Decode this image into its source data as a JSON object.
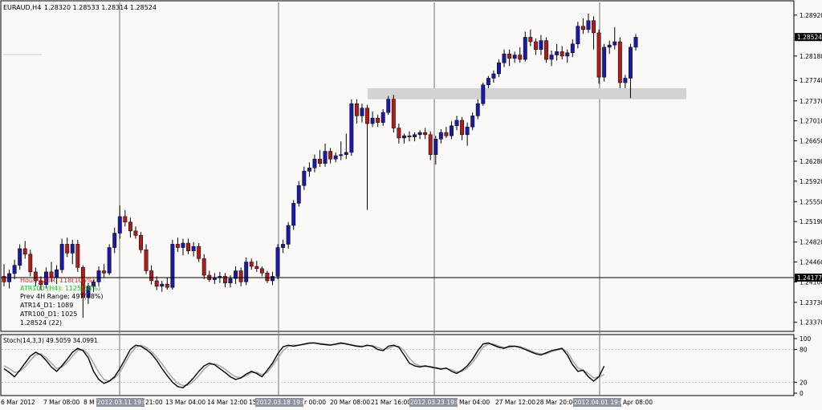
{
  "header": {
    "symbol": "EURAUD,H4",
    "ohlc": "1.28320 1.28533 1.28314 1.28524"
  },
  "indicators": {
    "line1": "Hourly ATR: 118(105%)",
    "line2": "ATR100 (H4): 1125(38%)",
    "line3": "Prev 4H Range: 497(48%)",
    "line4": "ATR14_D1: 1089",
    "line5": "ATR100_D1: 1025",
    "line6": "1.28524 (22)"
  },
  "price_axis": {
    "ticks": [
      "1.28920",
      "1.28180",
      "1.27740",
      "1.27370",
      "1.27010",
      "1.26650",
      "1.26280",
      "1.25920",
      "1.25550",
      "1.25190",
      "1.24820",
      "1.24460",
      "1.24100",
      "1.23730",
      "1.23370"
    ],
    "current_price_label": "1.28524",
    "hline_price_label": "1.24177"
  },
  "stoch_panel": {
    "label": "Stoch(14,3,3) 49.5059 34.0991",
    "levels": [
      "100",
      "80",
      "20",
      "0"
    ]
  },
  "time_axis": {
    "labels": [
      "6 Mar 2012",
      "7 Mar 08:00",
      "8 M",
      "13 Mar 04:00",
      "14 Mar 12:00",
      "15",
      "20 Mar 08:00",
      "21 Mar 16:00",
      "27 Mar 12:00",
      "28 Mar 20:00",
      "Apr 08:00"
    ],
    "highlighted": [
      "2012.03.11 19:00",
      "2012.03.18 19:00",
      "2012.03.23 19:00",
      "2012.04.01 19:00"
    ],
    "partial": [
      "21:00",
      "r 00:00",
      "Mar 04:00"
    ]
  },
  "colors": {
    "bull": "#1a1aa6",
    "bear": "#b01c1c",
    "background": "#fbf8f8",
    "zone": "#d3d3d3"
  },
  "chart_data": {
    "type": "candlestick",
    "ylim": [
      1.2322,
      1.2915
    ],
    "current_price": 1.28524,
    "hline_price": 1.24177,
    "zone": [
      1.274,
      1.276
    ],
    "candles": [
      {
        "o": 1.242,
        "h": 1.2442,
        "l": 1.2402,
        "c": 1.241
      },
      {
        "o": 1.241,
        "h": 1.2432,
        "l": 1.2398,
        "c": 1.2425
      },
      {
        "o": 1.2425,
        "h": 1.245,
        "l": 1.2415,
        "c": 1.244
      },
      {
        "o": 1.244,
        "h": 1.2478,
        "l": 1.2432,
        "c": 1.247
      },
      {
        "o": 1.247,
        "h": 1.2484,
        "l": 1.2452,
        "c": 1.246
      },
      {
        "o": 1.246,
        "h": 1.2468,
        "l": 1.242,
        "c": 1.2428
      },
      {
        "o": 1.2428,
        "h": 1.2436,
        "l": 1.2402,
        "c": 1.2412
      },
      {
        "o": 1.2412,
        "h": 1.242,
        "l": 1.2395,
        "c": 1.2405
      },
      {
        "o": 1.2405,
        "h": 1.2436,
        "l": 1.2398,
        "c": 1.2428
      },
      {
        "o": 1.2428,
        "h": 1.2446,
        "l": 1.241,
        "c": 1.2418
      },
      {
        "o": 1.2418,
        "h": 1.244,
        "l": 1.2406,
        "c": 1.2432
      },
      {
        "o": 1.2432,
        "h": 1.2488,
        "l": 1.2426,
        "c": 1.2478
      },
      {
        "o": 1.2478,
        "h": 1.249,
        "l": 1.2455,
        "c": 1.2462
      },
      {
        "o": 1.2462,
        "h": 1.2486,
        "l": 1.2442,
        "c": 1.2478
      },
      {
        "o": 1.2478,
        "h": 1.2486,
        "l": 1.2428,
        "c": 1.2436
      },
      {
        "o": 1.2436,
        "h": 1.244,
        "l": 1.2345,
        "c": 1.2382
      },
      {
        "o": 1.2382,
        "h": 1.2408,
        "l": 1.237,
        "c": 1.2402
      },
      {
        "o": 1.2402,
        "h": 1.2414,
        "l": 1.2392,
        "c": 1.241
      },
      {
        "o": 1.241,
        "h": 1.2438,
        "l": 1.2402,
        "c": 1.243
      },
      {
        "o": 1.243,
        "h": 1.2442,
        "l": 1.2418,
        "c": 1.2426
      },
      {
        "o": 1.2426,
        "h": 1.2478,
        "l": 1.2422,
        "c": 1.2472
      },
      {
        "o": 1.2472,
        "h": 1.2508,
        "l": 1.2462,
        "c": 1.2498
      },
      {
        "o": 1.2498,
        "h": 1.2548,
        "l": 1.2488,
        "c": 1.2528
      },
      {
        "o": 1.2528,
        "h": 1.254,
        "l": 1.251,
        "c": 1.2518
      },
      {
        "o": 1.2518,
        "h": 1.2526,
        "l": 1.249,
        "c": 1.2502
      },
      {
        "o": 1.2502,
        "h": 1.251,
        "l": 1.2488,
        "c": 1.2494
      },
      {
        "o": 1.2494,
        "h": 1.25,
        "l": 1.2462,
        "c": 1.2468
      },
      {
        "o": 1.2468,
        "h": 1.2478,
        "l": 1.2424,
        "c": 1.243
      },
      {
        "o": 1.243,
        "h": 1.244,
        "l": 1.2405,
        "c": 1.2412
      },
      {
        "o": 1.2412,
        "h": 1.242,
        "l": 1.2395,
        "c": 1.2402
      },
      {
        "o": 1.2402,
        "h": 1.2412,
        "l": 1.2392,
        "c": 1.2406
      },
      {
        "o": 1.2406,
        "h": 1.2418,
        "l": 1.2396,
        "c": 1.24
      },
      {
        "o": 1.24,
        "h": 1.2486,
        "l": 1.2396,
        "c": 1.2478
      },
      {
        "o": 1.2478,
        "h": 1.249,
        "l": 1.2464,
        "c": 1.2472
      },
      {
        "o": 1.2472,
        "h": 1.2488,
        "l": 1.2458,
        "c": 1.248
      },
      {
        "o": 1.248,
        "h": 1.2488,
        "l": 1.246,
        "c": 1.2466
      },
      {
        "o": 1.2466,
        "h": 1.2482,
        "l": 1.2456,
        "c": 1.2474
      },
      {
        "o": 1.2474,
        "h": 1.248,
        "l": 1.2446,
        "c": 1.2452
      },
      {
        "o": 1.2452,
        "h": 1.246,
        "l": 1.2415,
        "c": 1.2422
      },
      {
        "o": 1.2422,
        "h": 1.243,
        "l": 1.241,
        "c": 1.2414
      },
      {
        "o": 1.2414,
        "h": 1.2426,
        "l": 1.2406,
        "c": 1.2418
      },
      {
        "o": 1.2418,
        "h": 1.2428,
        "l": 1.2408,
        "c": 1.242
      },
      {
        "o": 1.242,
        "h": 1.2426,
        "l": 1.24,
        "c": 1.2408
      },
      {
        "o": 1.2408,
        "h": 1.2422,
        "l": 1.24,
        "c": 1.2416
      },
      {
        "o": 1.2416,
        "h": 1.2438,
        "l": 1.2406,
        "c": 1.243
      },
      {
        "o": 1.243,
        "h": 1.2436,
        "l": 1.2402,
        "c": 1.241
      },
      {
        "o": 1.241,
        "h": 1.2454,
        "l": 1.2404,
        "c": 1.2446
      },
      {
        "o": 1.2446,
        "h": 1.2452,
        "l": 1.2432,
        "c": 1.2438
      },
      {
        "o": 1.2438,
        "h": 1.2448,
        "l": 1.2428,
        "c": 1.2434
      },
      {
        "o": 1.2434,
        "h": 1.2438,
        "l": 1.242,
        "c": 1.2426
      },
      {
        "o": 1.2426,
        "h": 1.243,
        "l": 1.2408,
        "c": 1.2412
      },
      {
        "o": 1.2412,
        "h": 1.2428,
        "l": 1.2404,
        "c": 1.242
      },
      {
        "o": 1.242,
        "h": 1.2478,
        "l": 1.2415,
        "c": 1.2472
      },
      {
        "o": 1.2472,
        "h": 1.2486,
        "l": 1.2462,
        "c": 1.2478
      },
      {
        "o": 1.2478,
        "h": 1.2518,
        "l": 1.247,
        "c": 1.2512
      },
      {
        "o": 1.2512,
        "h": 1.2558,
        "l": 1.2504,
        "c": 1.2552
      },
      {
        "o": 1.2552,
        "h": 1.2592,
        "l": 1.2546,
        "c": 1.2584
      },
      {
        "o": 1.2584,
        "h": 1.2618,
        "l": 1.2576,
        "c": 1.261
      },
      {
        "o": 1.261,
        "h": 1.2626,
        "l": 1.26,
        "c": 1.2616
      },
      {
        "o": 1.2616,
        "h": 1.264,
        "l": 1.2608,
        "c": 1.2632
      },
      {
        "o": 1.2632,
        "h": 1.2648,
        "l": 1.2618,
        "c": 1.2624
      },
      {
        "o": 1.2624,
        "h": 1.266,
        "l": 1.2618,
        "c": 1.2646
      },
      {
        "o": 1.2646,
        "h": 1.2652,
        "l": 1.2624,
        "c": 1.2632
      },
      {
        "o": 1.2632,
        "h": 1.2644,
        "l": 1.2626,
        "c": 1.2638
      },
      {
        "o": 1.2638,
        "h": 1.2664,
        "l": 1.263,
        "c": 1.264
      },
      {
        "o": 1.264,
        "h": 1.2678,
        "l": 1.2632,
        "c": 1.2644
      },
      {
        "o": 1.2644,
        "h": 1.274,
        "l": 1.2638,
        "c": 1.2732
      },
      {
        "o": 1.2732,
        "h": 1.274,
        "l": 1.2696,
        "c": 1.271
      },
      {
        "o": 1.271,
        "h": 1.2732,
        "l": 1.2698,
        "c": 1.2724
      },
      {
        "o": 1.2724,
        "h": 1.273,
        "l": 1.254,
        "c": 1.2696
      },
      {
        "o": 1.2696,
        "h": 1.2718,
        "l": 1.269,
        "c": 1.2706
      },
      {
        "o": 1.2706,
        "h": 1.2712,
        "l": 1.269,
        "c": 1.2698
      },
      {
        "o": 1.2698,
        "h": 1.2722,
        "l": 1.2692,
        "c": 1.2716
      },
      {
        "o": 1.2716,
        "h": 1.2746,
        "l": 1.2712,
        "c": 1.274
      },
      {
        "o": 1.274,
        "h": 1.2748,
        "l": 1.268,
        "c": 1.2688
      },
      {
        "o": 1.2688,
        "h": 1.2696,
        "l": 1.266,
        "c": 1.267
      },
      {
        "o": 1.267,
        "h": 1.2678,
        "l": 1.266,
        "c": 1.2674
      },
      {
        "o": 1.2674,
        "h": 1.2682,
        "l": 1.2664,
        "c": 1.2672
      },
      {
        "o": 1.2672,
        "h": 1.268,
        "l": 1.2664,
        "c": 1.2676
      },
      {
        "o": 1.2676,
        "h": 1.2684,
        "l": 1.2668,
        "c": 1.268
      },
      {
        "o": 1.268,
        "h": 1.2688,
        "l": 1.2668,
        "c": 1.2676
      },
      {
        "o": 1.2676,
        "h": 1.2682,
        "l": 1.263,
        "c": 1.264
      },
      {
        "o": 1.264,
        "h": 1.2674,
        "l": 1.2622,
        "c": 1.2668
      },
      {
        "o": 1.2668,
        "h": 1.2686,
        "l": 1.266,
        "c": 1.268
      },
      {
        "o": 1.268,
        "h": 1.269,
        "l": 1.267,
        "c": 1.2674
      },
      {
        "o": 1.2674,
        "h": 1.27,
        "l": 1.2668,
        "c": 1.2692
      },
      {
        "o": 1.2692,
        "h": 1.271,
        "l": 1.2684,
        "c": 1.2702
      },
      {
        "o": 1.2702,
        "h": 1.2708,
        "l": 1.2666,
        "c": 1.2676
      },
      {
        "o": 1.2676,
        "h": 1.2698,
        "l": 1.2656,
        "c": 1.269
      },
      {
        "o": 1.269,
        "h": 1.2716,
        "l": 1.2684,
        "c": 1.271
      },
      {
        "o": 1.271,
        "h": 1.274,
        "l": 1.2704,
        "c": 1.2732
      },
      {
        "o": 1.2732,
        "h": 1.277,
        "l": 1.2728,
        "c": 1.2766
      },
      {
        "o": 1.2766,
        "h": 1.2782,
        "l": 1.276,
        "c": 1.2778
      },
      {
        "o": 1.2778,
        "h": 1.2792,
        "l": 1.277,
        "c": 1.2786
      },
      {
        "o": 1.2786,
        "h": 1.2812,
        "l": 1.278,
        "c": 1.2806
      },
      {
        "o": 1.2806,
        "h": 1.283,
        "l": 1.2798,
        "c": 1.2822
      },
      {
        "o": 1.2822,
        "h": 1.283,
        "l": 1.28,
        "c": 1.2814
      },
      {
        "o": 1.2814,
        "h": 1.2826,
        "l": 1.2806,
        "c": 1.282
      },
      {
        "o": 1.282,
        "h": 1.2834,
        "l": 1.2806,
        "c": 1.2812
      },
      {
        "o": 1.2812,
        "h": 1.2862,
        "l": 1.2808,
        "c": 1.2852
      },
      {
        "o": 1.2852,
        "h": 1.2866,
        "l": 1.2836,
        "c": 1.2844
      },
      {
        "o": 1.2844,
        "h": 1.285,
        "l": 1.282,
        "c": 1.283
      },
      {
        "o": 1.283,
        "h": 1.2856,
        "l": 1.282,
        "c": 1.2846
      },
      {
        "o": 1.2846,
        "h": 1.2852,
        "l": 1.2806,
        "c": 1.2812
      },
      {
        "o": 1.2812,
        "h": 1.2828,
        "l": 1.28,
        "c": 1.282
      },
      {
        "o": 1.282,
        "h": 1.284,
        "l": 1.281,
        "c": 1.2826
      },
      {
        "o": 1.2826,
        "h": 1.2836,
        "l": 1.2812,
        "c": 1.2818
      },
      {
        "o": 1.2818,
        "h": 1.283,
        "l": 1.2806,
        "c": 1.2824
      },
      {
        "o": 1.2824,
        "h": 1.2848,
        "l": 1.2816,
        "c": 1.284
      },
      {
        "o": 1.284,
        "h": 1.288,
        "l": 1.2832,
        "c": 1.2872
      },
      {
        "o": 1.2872,
        "h": 1.2886,
        "l": 1.2858,
        "c": 1.2866
      },
      {
        "o": 1.2866,
        "h": 1.2895,
        "l": 1.286,
        "c": 1.2882
      },
      {
        "o": 1.2882,
        "h": 1.289,
        "l": 1.283,
        "c": 1.286
      },
      {
        "o": 1.286,
        "h": 1.2866,
        "l": 1.2768,
        "c": 1.278
      },
      {
        "o": 1.278,
        "h": 1.284,
        "l": 1.2772,
        "c": 1.2834
      },
      {
        "o": 1.2834,
        "h": 1.2846,
        "l": 1.2822,
        "c": 1.2838
      },
      {
        "o": 1.2838,
        "h": 1.287,
        "l": 1.283,
        "c": 1.2844
      },
      {
        "o": 1.2844,
        "h": 1.2852,
        "l": 1.276,
        "c": 1.277
      },
      {
        "o": 1.277,
        "h": 1.2784,
        "l": 1.276,
        "c": 1.2778
      },
      {
        "o": 1.2778,
        "h": 1.284,
        "l": 1.2742,
        "c": 1.2834
      },
      {
        "o": 1.2834,
        "h": 1.2858,
        "l": 1.2828,
        "c": 1.2852
      }
    ],
    "stoch_main": [
      45,
      38,
      30,
      42,
      55,
      68,
      75,
      70,
      60,
      48,
      40,
      50,
      62,
      75,
      82,
      78,
      65,
      40,
      25,
      18,
      22,
      30,
      45,
      62,
      80,
      88,
      86,
      80,
      72,
      60,
      45,
      32,
      20,
      12,
      10,
      18,
      28,
      40,
      50,
      55,
      52,
      45,
      38,
      30,
      25,
      28,
      35,
      40,
      36,
      30,
      42,
      55,
      72,
      85,
      88,
      86,
      88,
      90,
      92,
      92,
      90,
      89,
      88,
      90,
      92,
      90,
      88,
      86,
      85,
      88,
      86,
      80,
      78,
      86,
      88,
      84,
      70,
      55,
      50,
      48,
      50,
      48,
      46,
      44,
      46,
      40,
      36,
      42,
      50,
      62,
      78,
      90,
      92,
      88,
      84,
      82,
      86,
      86,
      84,
      80,
      76,
      72,
      70,
      74,
      78,
      80,
      82,
      70,
      52,
      40,
      42,
      30,
      22,
      30,
      49.5
    ],
    "stoch_signal": [
      50,
      45,
      38,
      40,
      48,
      60,
      70,
      72,
      65,
      55,
      45,
      48,
      56,
      68,
      78,
      80,
      72,
      55,
      38,
      25,
      22,
      28,
      38,
      55,
      72,
      84,
      88,
      84,
      76,
      66,
      54,
      40,
      28,
      18,
      14,
      15,
      22,
      32,
      44,
      52,
      54,
      50,
      44,
      36,
      30,
      28,
      32,
      38,
      38,
      34,
      38,
      50,
      64,
      78,
      86,
      88,
      88,
      89,
      91,
      92,
      91,
      90,
      89,
      89,
      91,
      91,
      89,
      87,
      86,
      87,
      87,
      84,
      80,
      82,
      86,
      86,
      78,
      64,
      54,
      50,
      49,
      49,
      47,
      45,
      45,
      43,
      39,
      40,
      46,
      56,
      70,
      84,
      90,
      90,
      86,
      84,
      84,
      86,
      85,
      82,
      78,
      74,
      72,
      72,
      76,
      79,
      81,
      76,
      60,
      46,
      42,
      36,
      28,
      30,
      34.1
    ]
  }
}
